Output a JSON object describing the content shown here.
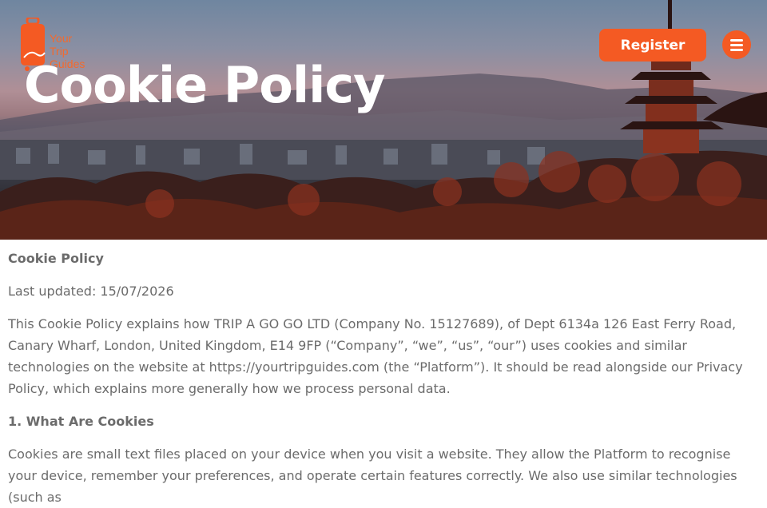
{
  "brand": {
    "logo_line1": "Your",
    "logo_line2": "Trip",
    "logo_line3": "Guides",
    "color": "#f26a2e"
  },
  "hero": {
    "title": "Cookie Policy"
  },
  "header": {
    "register_label": "Register",
    "menu_icon": "hamburger-icon",
    "accent": "#f45a23"
  },
  "content": {
    "heading": "Cookie Policy",
    "last_updated": "Last updated: 15/07/2026",
    "intro": "This Cookie Policy explains how TRIP A GO GO LTD (Company No. 15127689), of Dept 6134a 126 East Ferry Road, Canary Wharf, London, United Kingdom, E14 9FP (“Company”, “we”, “us”, “our”) uses cookies and similar technologies on the website at https://yourtripguides.com (the “Platform”). It should be read alongside our Privacy Policy, which explains more generally how we process personal data.",
    "section1_heading": "1. What Are Cookies",
    "section1_text": "Cookies are small text files placed on your device when you visit a website. They allow the Platform to recognise your device, remember your preferences, and operate certain features correctly. We also use similar technologies (such as"
  }
}
